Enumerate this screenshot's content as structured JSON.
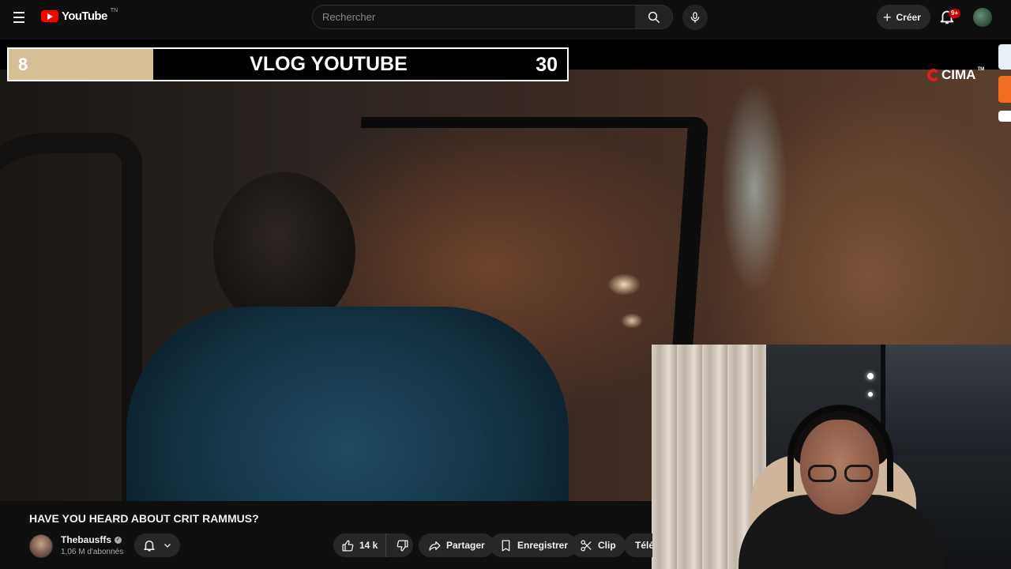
{
  "header": {
    "logo_text": "YouTube",
    "logo_country": "TN",
    "search_placeholder": "Rechercher",
    "create_label": "Créer",
    "notification_count": "9+"
  },
  "overlay": {
    "left_number": "8",
    "title": "VLOG YOUTUBE",
    "right_number": "30",
    "brand": "CIMA",
    "brand_tm": "TM"
  },
  "video": {
    "title": "HAVE YOU HEARD ABOUT CRIT RAMMUS?",
    "channel_name": "Thebausffs",
    "subscribers": "1,06 M d'abonnés"
  },
  "actions": {
    "likes": "14 k",
    "share_label": "Partager",
    "save_label": "Enregistrer",
    "clip_label": "Clip",
    "download_label": "Télécharger"
  },
  "icons": {
    "menu": "hamburger-icon",
    "search": "search-icon",
    "mic": "mic-icon",
    "bell": "bell-icon",
    "like": "thumbs-up-icon",
    "dislike": "thumbs-down-icon",
    "share": "share-arrow-icon",
    "save": "bookmark-icon",
    "clip": "scissors-icon",
    "download": "download-icon"
  },
  "colors": {
    "background": "#0f0f0f",
    "brand_red": "#ff0000",
    "button_bg": "#272727",
    "overlay_gold": "#d5bf95",
    "badge_red": "#cc0000"
  }
}
